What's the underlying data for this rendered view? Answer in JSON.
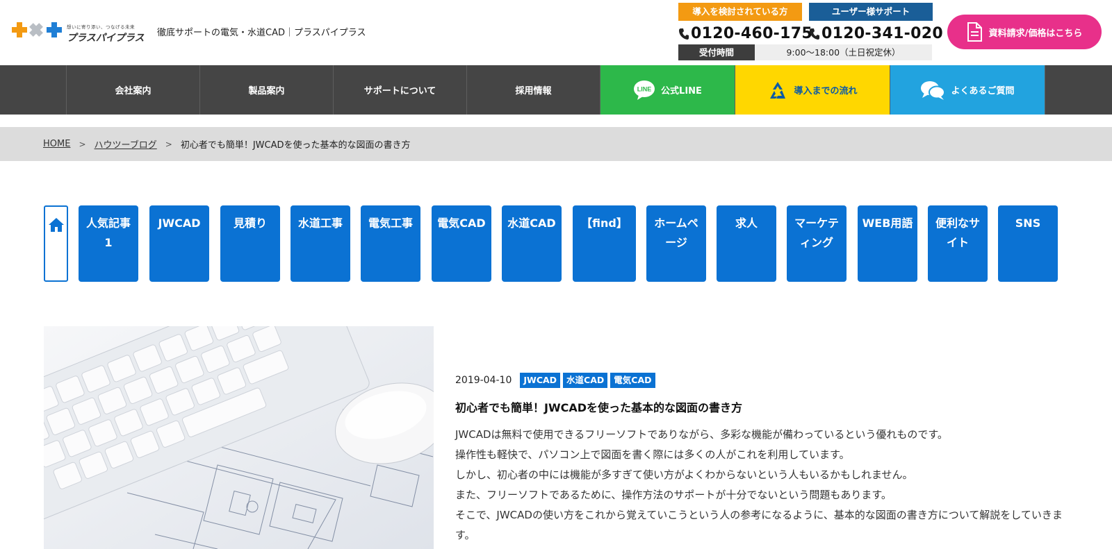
{
  "header": {
    "logo_tagline": "想いに寄り添い、つなげる未来",
    "logo_name": "プラスパイプラス",
    "site_title": "徹底サポートの電気・水道CAD｜プラスパイプラス",
    "tel_prospect_label": "導入を検討されている方",
    "tel_prospect_number": "0120-460-175",
    "tel_user_label": "ユーザー様サポート",
    "tel_user_number": "0120-341-020",
    "hours_label": "受付時間",
    "hours_value": "9:00〜18:00（土日祝定休）",
    "request_button": "資料請求/価格はこちら",
    "colors": {
      "orange": "#f39a12",
      "navy": "#1a5e98",
      "pink": "#e8308a"
    }
  },
  "nav": {
    "items": [
      "会社案内",
      "製品案内",
      "サポートについて",
      "採用情報"
    ],
    "line_label": "公式LINE",
    "line_icon_text": "LINE",
    "flow_label": "導入までの流れ",
    "faq_label": "よくあるご質問",
    "colors": {
      "line": "#2db84a",
      "flow": "#ffd700",
      "faq": "#22a3df"
    }
  },
  "breadcrumb": {
    "home": "HOME",
    "blog": "ハウツーブログ",
    "current": "初心者でも簡単！JWCADを使った基本的な図面の書き方"
  },
  "categories": [
    "人気記事1",
    "JWCAD",
    "見積り",
    "水道工事",
    "電気工事",
    "電気CAD",
    "水道CAD",
    "【find】",
    "ホームページ",
    "求人",
    "マーケティング",
    "WEB用語",
    "便利なサイト",
    "SNS"
  ],
  "article": {
    "date": "2019-04-10",
    "tags": [
      "JWCAD",
      "水道CAD",
      "電気CAD"
    ],
    "title": "初心者でも簡単！JWCADを使った基本的な図面の書き方",
    "excerpt": [
      "JWCADは無料で使用できるフリーソフトでありながら、多彩な機能が備わっているという優れものです。",
      "操作性も軽快で、パソコン上で図面を書く際には多くの人がこれを利用しています。",
      "しかし、初心者の中には機能が多すぎて使い方がよくわからないという人もいるかもしれません。",
      "また、フリーソフトであるために、操作方法のサポートが十分でないという問題もあります。",
      "そこで、JWCADの使い方をこれから覚えていこうという人の参考になるように、基本的な図面の書き方について解説をしていきます。"
    ]
  },
  "icons": {
    "phone": "phone-icon",
    "document": "document-icon",
    "line": "line-icon",
    "flow": "recycle-icon",
    "faq": "chat-bubbles-icon",
    "home": "home-icon"
  },
  "accent": "#0b72d3"
}
